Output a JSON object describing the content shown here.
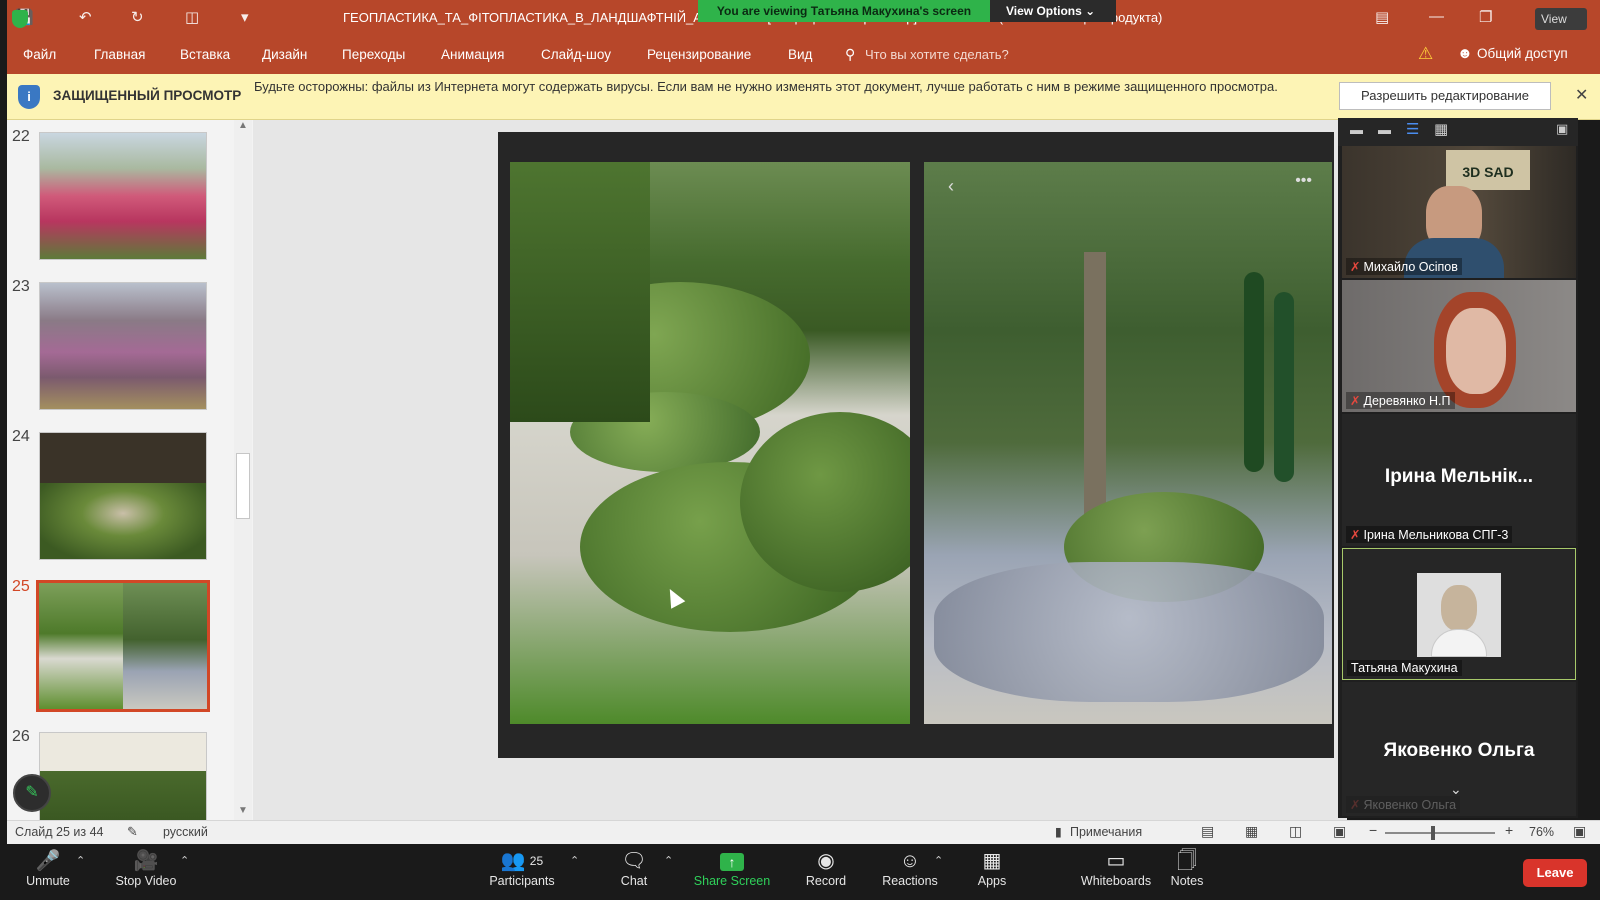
{
  "titlebar": {
    "title": "ГЕОПЛАСТИКА_ТА_ФІТОПЛАСТИКА_В_ЛАНДШАФТНІЙ_АРХІТЕКТ... [Защищенный просмотр] - PowerPoint (Сбой активации продукта)",
    "viewing_banner": "You are viewing Татьяна Макухина's screen",
    "view_options": "View Options",
    "view_button": "View"
  },
  "ribbon": {
    "tabs": [
      "Файл",
      "Главная",
      "Вставка",
      "Дизайн",
      "Переходы",
      "Анимация",
      "Слайд-шоу",
      "Рецензирование",
      "Вид"
    ],
    "tell_me": "Что вы хотите сделать?",
    "share": "Общий доступ"
  },
  "protected_view": {
    "title": "ЗАЩИЩЕННЫЙ ПРОСМОТР",
    "message": "Будьте осторожны: файлы из Интернета могут содержать вирусы. Если вам не нужно изменять этот документ, лучше работать с ним в режиме защищенного просмотра.",
    "enable_button": "Разрешить редактирование"
  },
  "slides": {
    "numbers": [
      "22",
      "23",
      "24",
      "25",
      "26"
    ],
    "active": "25"
  },
  "gallery": {
    "participants": [
      {
        "name": "Михайло Осіпов",
        "muted": true,
        "tile_label": "3D SAD"
      },
      {
        "name": "Деревянко Н.П",
        "muted": true
      },
      {
        "name": "Ірина Мельникова СПГ-3",
        "muted": true,
        "big_name": "Ірина Мельнік..."
      },
      {
        "name": "Татьяна Макухина",
        "muted": false
      },
      {
        "name": "Яковенко Ольга",
        "muted": true,
        "big_name": "Яковенко Ольга"
      }
    ]
  },
  "statusbar": {
    "slide_info": "Слайд 25 из 44",
    "language": "русский",
    "notes": "Примечания",
    "zoom": "76%"
  },
  "zoom_controls": {
    "unmute": "Unmute",
    "stop_video": "Stop Video",
    "participants": "Participants",
    "participant_count": "25",
    "chat": "Chat",
    "share_screen": "Share Screen",
    "record": "Record",
    "reactions": "Reactions",
    "apps": "Apps",
    "whiteboards": "Whiteboards",
    "notes": "Notes",
    "leave": "Leave"
  },
  "colors": {
    "ppt_accent": "#b7472a",
    "zoom_green": "#2fb34a",
    "leave_red": "#d9342b"
  }
}
